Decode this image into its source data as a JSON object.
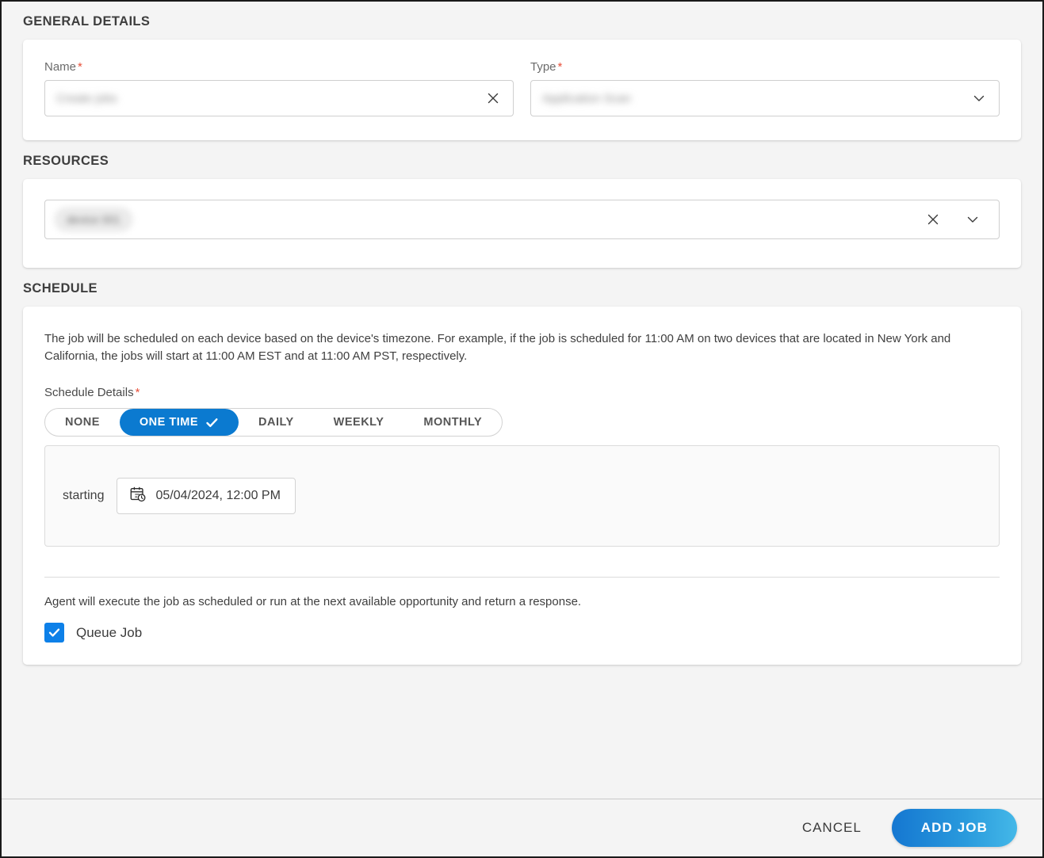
{
  "sections": {
    "general": {
      "title": "GENERAL DETAILS",
      "name_field": {
        "label": "Name",
        "required_marker": "*",
        "value": "Create jobs",
        "redacted": true,
        "clear_icon": "close-icon"
      },
      "type_field": {
        "label": "Type",
        "required_marker": "*",
        "value": "Application Scan",
        "redacted": true,
        "dropdown_icon": "chevron-down-icon"
      }
    },
    "resources": {
      "title": "RESOURCES",
      "selected_chips": [
        "device 001"
      ],
      "chips_redacted": true,
      "clear_icon": "close-icon",
      "dropdown_icon": "chevron-down-icon"
    },
    "schedule": {
      "title": "SCHEDULE",
      "note": "The job will be scheduled on each device based on the device's timezone. For example, if the job is scheduled for 11:00 AM on two devices that are located in New York and California, the jobs will start at 11:00 AM EST and at 11:00 AM PST, respectively.",
      "details_label": "Schedule Details",
      "details_required_marker": "*",
      "tabs": [
        {
          "label": "NONE",
          "active": false
        },
        {
          "label": "ONE TIME",
          "active": true
        },
        {
          "label": "DAILY",
          "active": false
        },
        {
          "label": "WEEKLY",
          "active": false
        },
        {
          "label": "MONTHLY",
          "active": false
        }
      ],
      "starting_label": "starting",
      "starting_value": "05/04/2024, 12:00 PM",
      "starting_icon": "calendar-clock-icon",
      "agent_note": "Agent will execute the job as scheduled or run at the next available opportunity and return a response.",
      "queue_job": {
        "label": "Queue Job",
        "checked": true
      }
    }
  },
  "footer": {
    "cancel_label": "CANCEL",
    "submit_label": "ADD JOB"
  },
  "colors": {
    "accent_blue": "#0b7ad0",
    "checkbox_blue": "#0d80e8",
    "button_gradient_start": "#1577d1",
    "button_gradient_end": "#44b8e8",
    "required_red": "#e8503a",
    "page_background": "#f4f4f4"
  }
}
